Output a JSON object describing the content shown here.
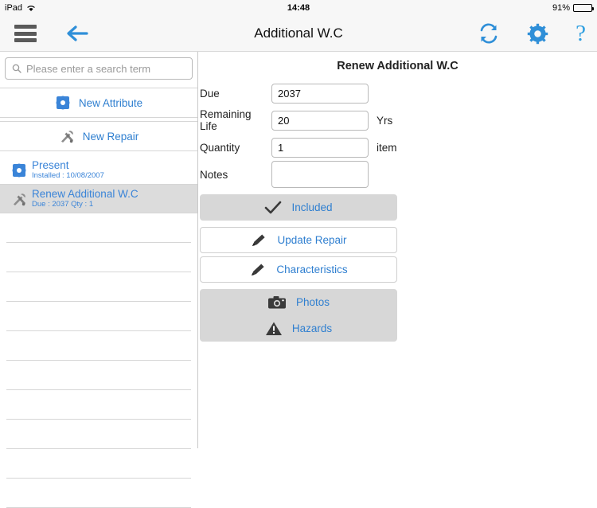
{
  "statusbar": {
    "device": "iPad",
    "wifi_icon": "wifi-icon",
    "time": "14:48",
    "battery_percent": "91%",
    "battery_level": 91
  },
  "navbar": {
    "menu_icon": "hamburger-menu-icon",
    "back_icon": "back-arrow-icon",
    "title": "Additional W.C",
    "refresh_icon": "refresh-sync-icon",
    "settings_icon": "gear-icon",
    "help_icon": "question-mark-icon",
    "help_label": "?"
  },
  "sidebar": {
    "search": {
      "placeholder": "Please enter a search term",
      "value": "",
      "icon": "search-icon"
    },
    "actions": [
      {
        "label": "New Attribute",
        "icon": "attribute-gear-icon"
      },
      {
        "label": "New Repair",
        "icon": "tools-icon"
      }
    ],
    "items": [
      {
        "title": "Present",
        "subtitle": "Installed : 10/08/2007",
        "icon": "attribute-gear-icon",
        "selected": false
      },
      {
        "title": "Renew Additional W.C",
        "subtitle": "Due : 2037   Qty : 1",
        "icon": "tools-icon",
        "selected": true
      }
    ],
    "empty_row_count": 10
  },
  "detail": {
    "title": "Renew Additional W.C",
    "fields": [
      {
        "label": "Due",
        "value": "2037",
        "unit": ""
      },
      {
        "label": "Remaining Life",
        "value": "20",
        "unit": "Yrs"
      },
      {
        "label": "Quantity",
        "value": "1",
        "unit": "item"
      },
      {
        "label": "Notes",
        "value": "",
        "unit": ""
      }
    ],
    "buttons": [
      {
        "label": "Included",
        "icon": "check-icon",
        "style": "grey"
      },
      {
        "label": "Update Repair",
        "icon": "pencil-icon",
        "style": "white"
      },
      {
        "label": "Characteristics",
        "icon": "pencil-icon",
        "style": "white"
      },
      {
        "label": "Photos",
        "icon": "camera-icon",
        "style": "grey"
      },
      {
        "label": "Hazards",
        "icon": "warning-triangle-icon",
        "style": "grey"
      }
    ]
  },
  "colors": {
    "accent_blue": "#2f7fd0",
    "link_blue": "#3a84d8",
    "bar_grey": "#f7f7f7",
    "button_grey": "#d7d7d7",
    "selected_row": "#dcdcdc"
  }
}
